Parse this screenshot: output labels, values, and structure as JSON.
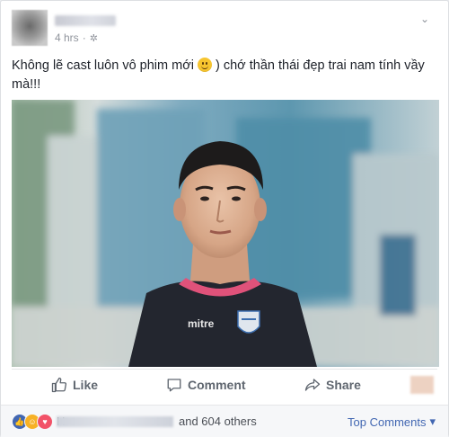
{
  "post": {
    "timestamp": "4 hrs",
    "separator": "·",
    "privacy_icon": "globe-icon",
    "menu_icon": "chevron-down-icon",
    "text_before_emoji": "Không lẽ cast luôn vô phim mới",
    "emoji_name": "smile-emoji",
    "text_after_emoji": ") chớ thần thái đẹp trai nam tính vầy mà!!!"
  },
  "photo": {
    "shirt_brand": "mitre",
    "subject": "player-photo"
  },
  "actions": {
    "like_label": "Like",
    "comment_label": "Comment",
    "share_label": "Share"
  },
  "reactions": {
    "types": [
      "like",
      "haha",
      "love"
    ],
    "first_initial": "H",
    "others_text": "and 604 others",
    "top_comments_label": "Top Comments"
  },
  "colors": {
    "brand_blue": "#4267b2",
    "action_gray": "#606770",
    "meta_gray": "#90949c",
    "love_red": "#f25268",
    "haha_yellow": "#f7b125"
  }
}
